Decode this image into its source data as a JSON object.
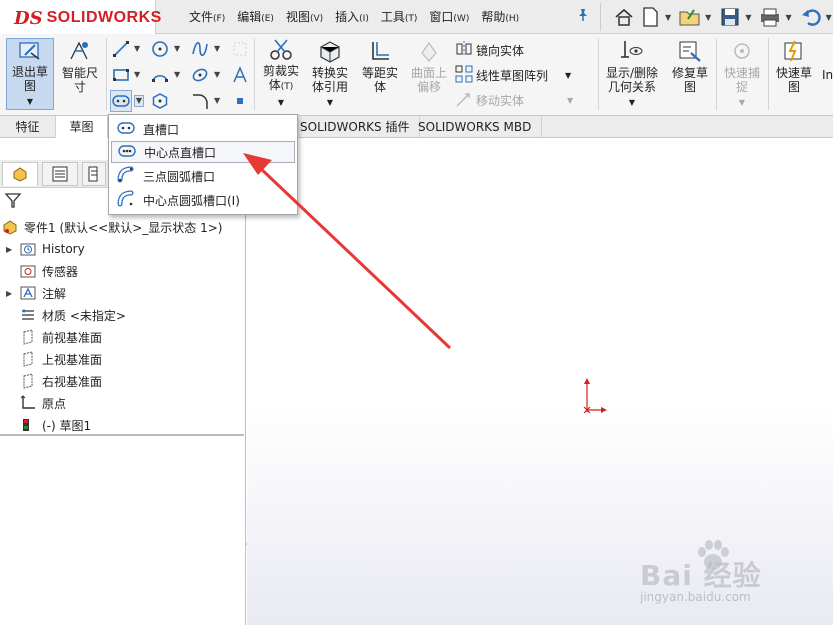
{
  "app": {
    "logo_ds": "DS",
    "logo_text": "SOLIDWORKS"
  },
  "menus": [
    {
      "label": "文件",
      "key": "(F)"
    },
    {
      "label": "编辑",
      "key": "(E)"
    },
    {
      "label": "视图",
      "key": "(V)"
    },
    {
      "label": "插入",
      "key": "(I)"
    },
    {
      "label": "工具",
      "key": "(T)"
    },
    {
      "label": "窗口",
      "key": "(W)"
    },
    {
      "label": "帮助",
      "key": "(H)"
    }
  ],
  "ribbon": {
    "exit_sketch": "退出草图",
    "smart_dimension": "智能尺寸",
    "trim": "剪裁实体",
    "trim_key": "(T)",
    "convert": "转换实体引用",
    "offset": "等距实体",
    "surface_offset": "曲面上偏移",
    "mirror": "镜向实体",
    "linear_pattern": "线性草图阵列",
    "move": "移动实体",
    "relations": "显示/删除几何关系",
    "repair": "修复草图",
    "quick_snap": "快速捕捉",
    "rapid_sketch": "快速草图",
    "overflow": "In"
  },
  "tabs": [
    "特征",
    "草图",
    "SOLIDWORKS 插件",
    "SOLIDWORKS MBD"
  ],
  "slot_menu": {
    "items": [
      "直槽口",
      "中心点直槽口",
      "三点圆弧槽口",
      "中心点圆弧槽口(I)"
    ],
    "highlighted_index": 1
  },
  "tree": {
    "root": "零件1 (默认<<默认>_显示状态 1>)",
    "items": [
      "History",
      "传感器",
      "注解",
      "材质 <未指定>",
      "前视基准面",
      "上视基准面",
      "右视基准面",
      "原点",
      "(-) 草图1"
    ]
  },
  "watermark": {
    "brand": "Bai 经验",
    "url": "jingyan.baidu.com"
  },
  "colors": {
    "brand_red": "#d21f26",
    "annotation_arrow": "#e53935",
    "active_tool_bg": "#c7d9ef",
    "icon_blue": "#2a6fc0"
  }
}
